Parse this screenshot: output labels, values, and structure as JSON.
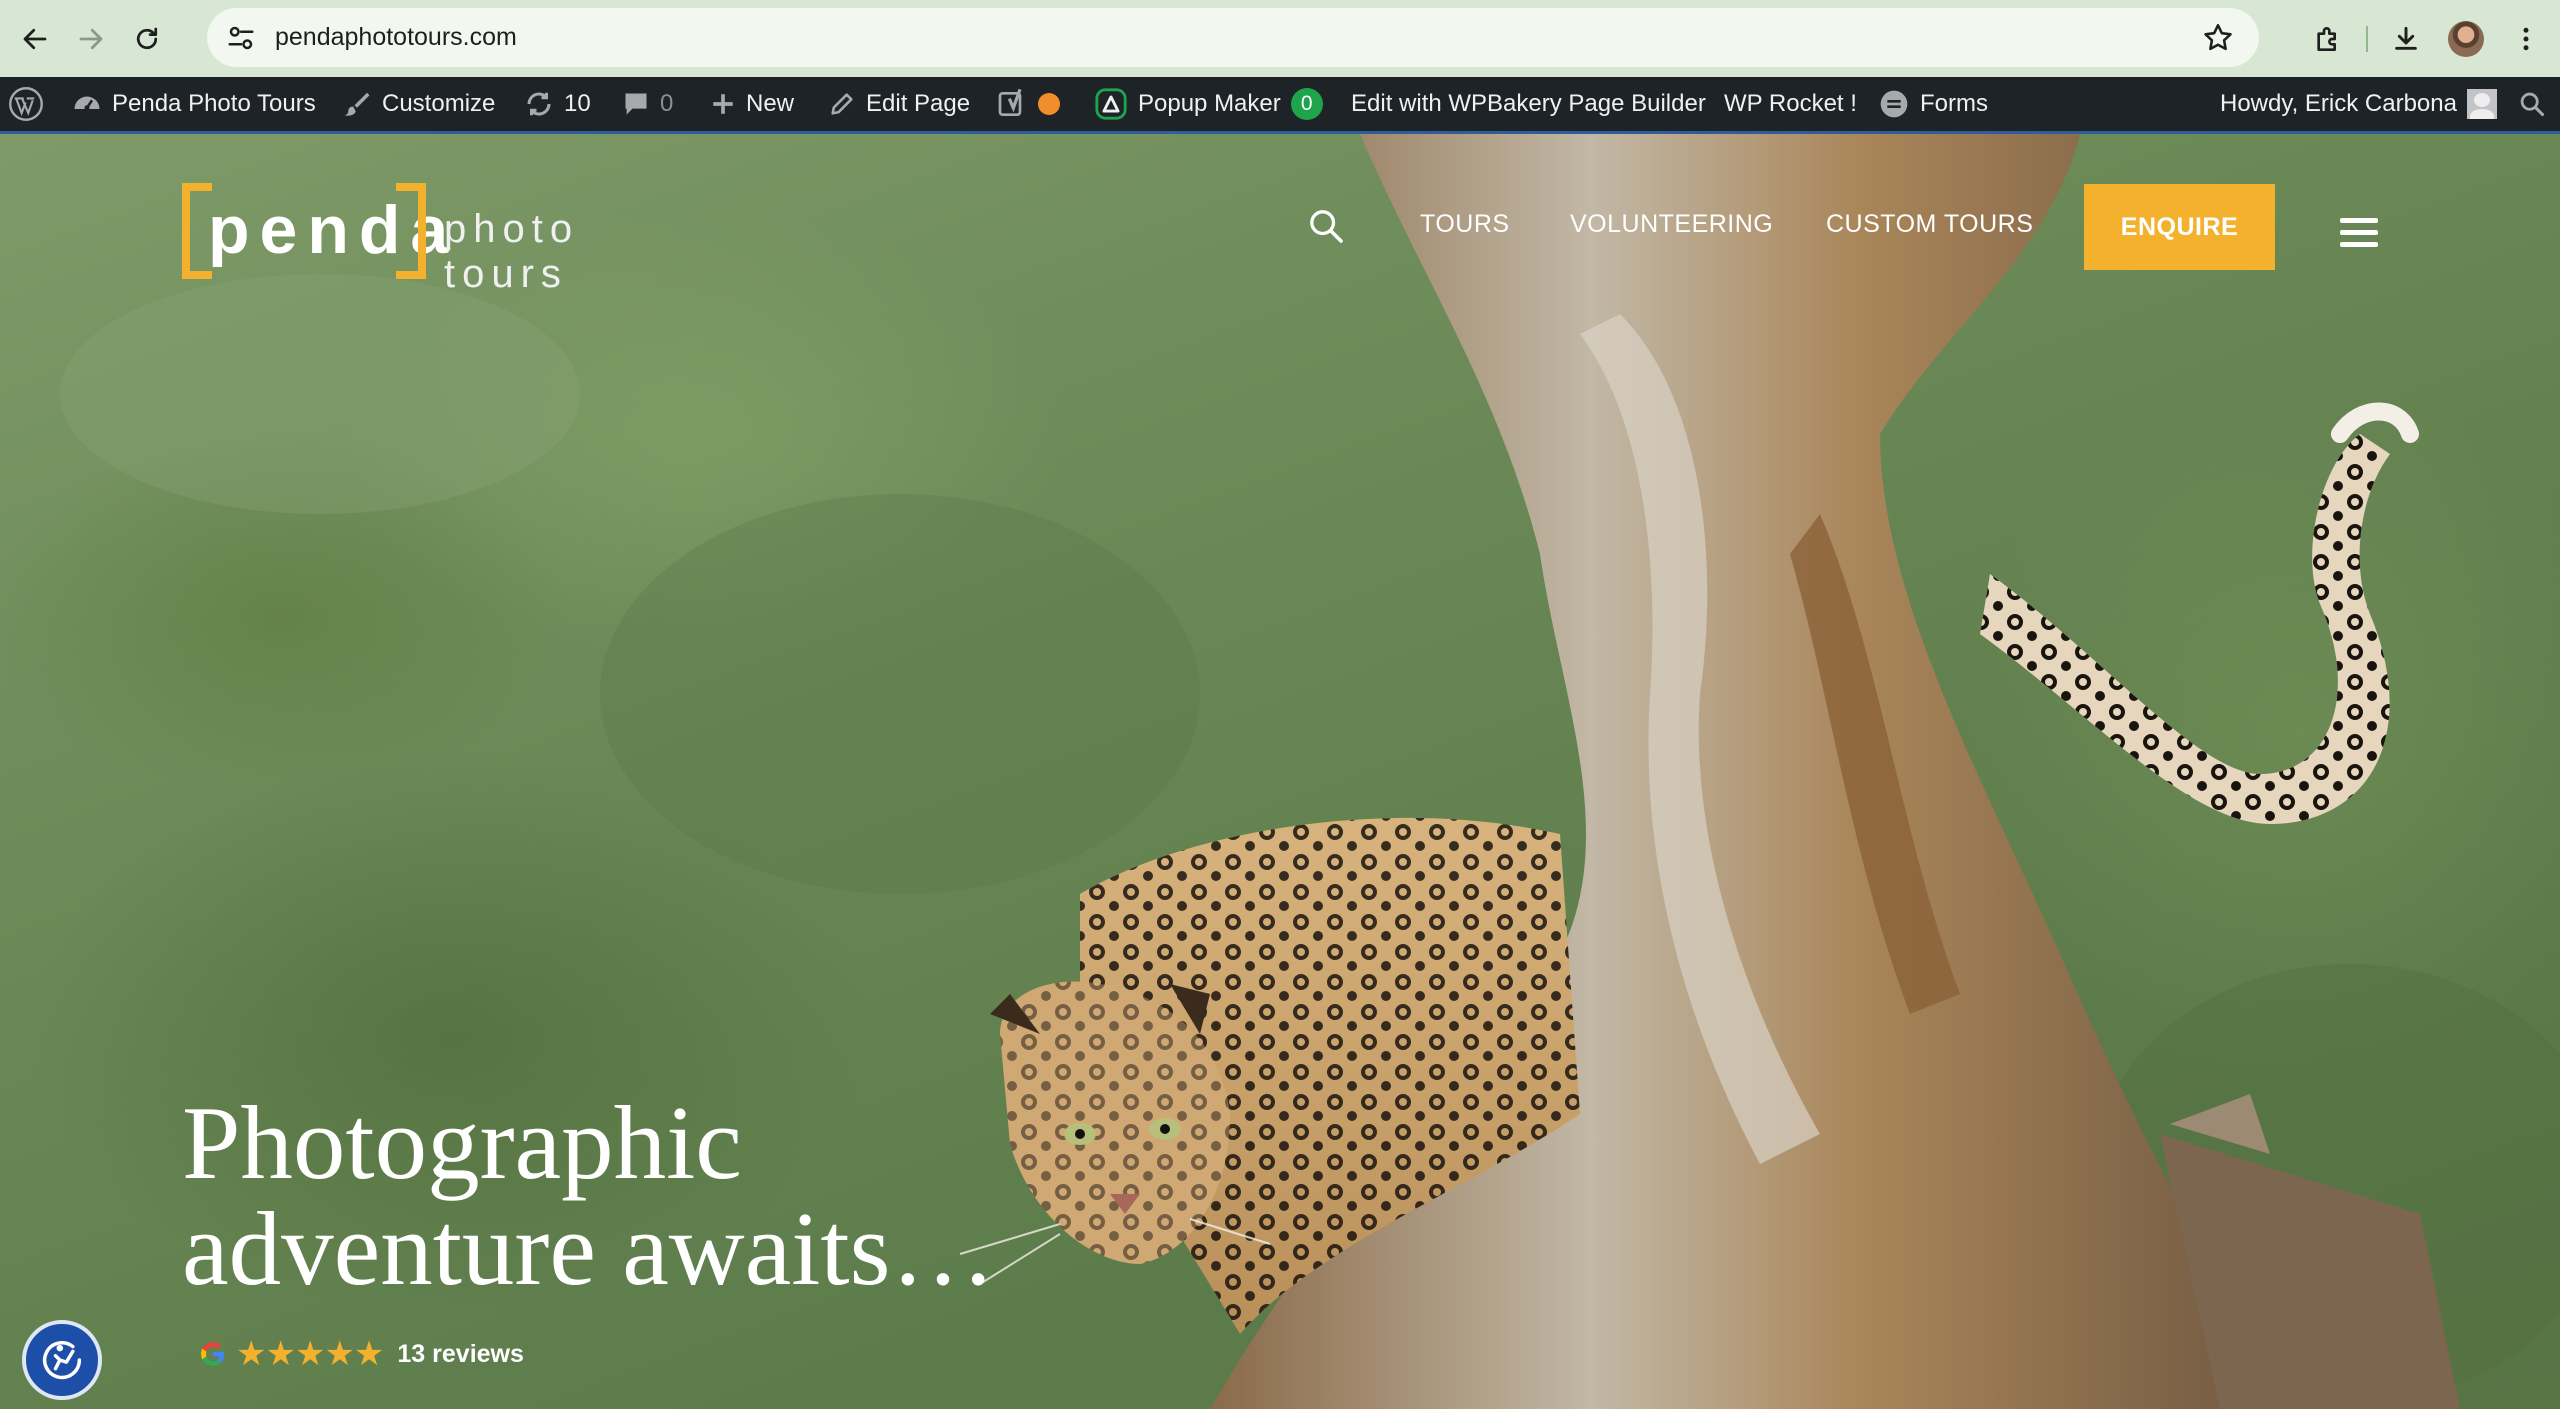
{
  "browser": {
    "url": "pendaphototours.com"
  },
  "admin_bar": {
    "site_name": "Penda Photo Tours",
    "customize": "Customize",
    "updates_count": "10",
    "comments_count": "0",
    "new": "New",
    "edit_page": "Edit Page",
    "popup_maker": "Popup Maker",
    "popup_maker_count": "0",
    "wpbakery": "Edit with WPBakery Page Builder",
    "wp_rocket": "WP Rocket !",
    "forms": "Forms",
    "howdy": "Howdy, Erick Carbona"
  },
  "logo": {
    "penda": "penda",
    "rest": "photo tours",
    "accent_color": "#f3b12d"
  },
  "nav": {
    "items": [
      "TOURS",
      "VOLUNTEERING",
      "CUSTOM TOURS"
    ],
    "enquire": "ENQUIRE"
  },
  "hero": {
    "heading_line1": "Photographic",
    "heading_line2": "adventure awaits…",
    "reviews": "13 reviews",
    "stars": "★★★★★",
    "rating": 5
  },
  "colors": {
    "chrome_bar": "#d7e7d3",
    "admin_bar": "#1d2327",
    "accent": "#f3b12d",
    "badge_green": "#1ea54b",
    "accessibility_blue": "#1e4fa8"
  }
}
